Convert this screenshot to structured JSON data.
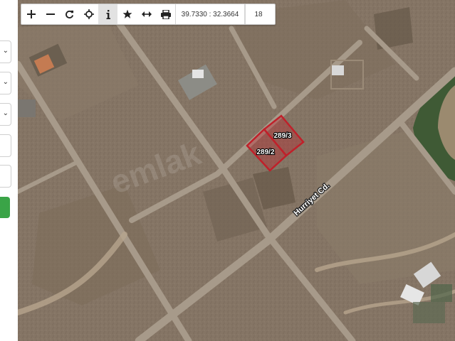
{
  "toolbar": {
    "tools": [
      {
        "name": "zoom-in-icon",
        "glyph": "+"
      },
      {
        "name": "zoom-out-icon",
        "glyph": "−"
      },
      {
        "name": "refresh-icon",
        "glyph": "↻"
      },
      {
        "name": "locate-icon",
        "glyph": "⌖"
      },
      {
        "name": "info-icon",
        "glyph": "i",
        "active": true
      },
      {
        "name": "star-icon",
        "glyph": "★"
      },
      {
        "name": "measure-icon",
        "glyph": "↔"
      },
      {
        "name": "print-icon",
        "glyph": "⎙"
      }
    ],
    "coordinates": "39.7330 : 32.3664",
    "zoom_level": "18"
  },
  "map": {
    "parcels": [
      {
        "label": "289/3"
      },
      {
        "label": "289/2"
      }
    ],
    "street_name": "Hurriyet Cd.",
    "parcel_color": "#c0202a"
  }
}
